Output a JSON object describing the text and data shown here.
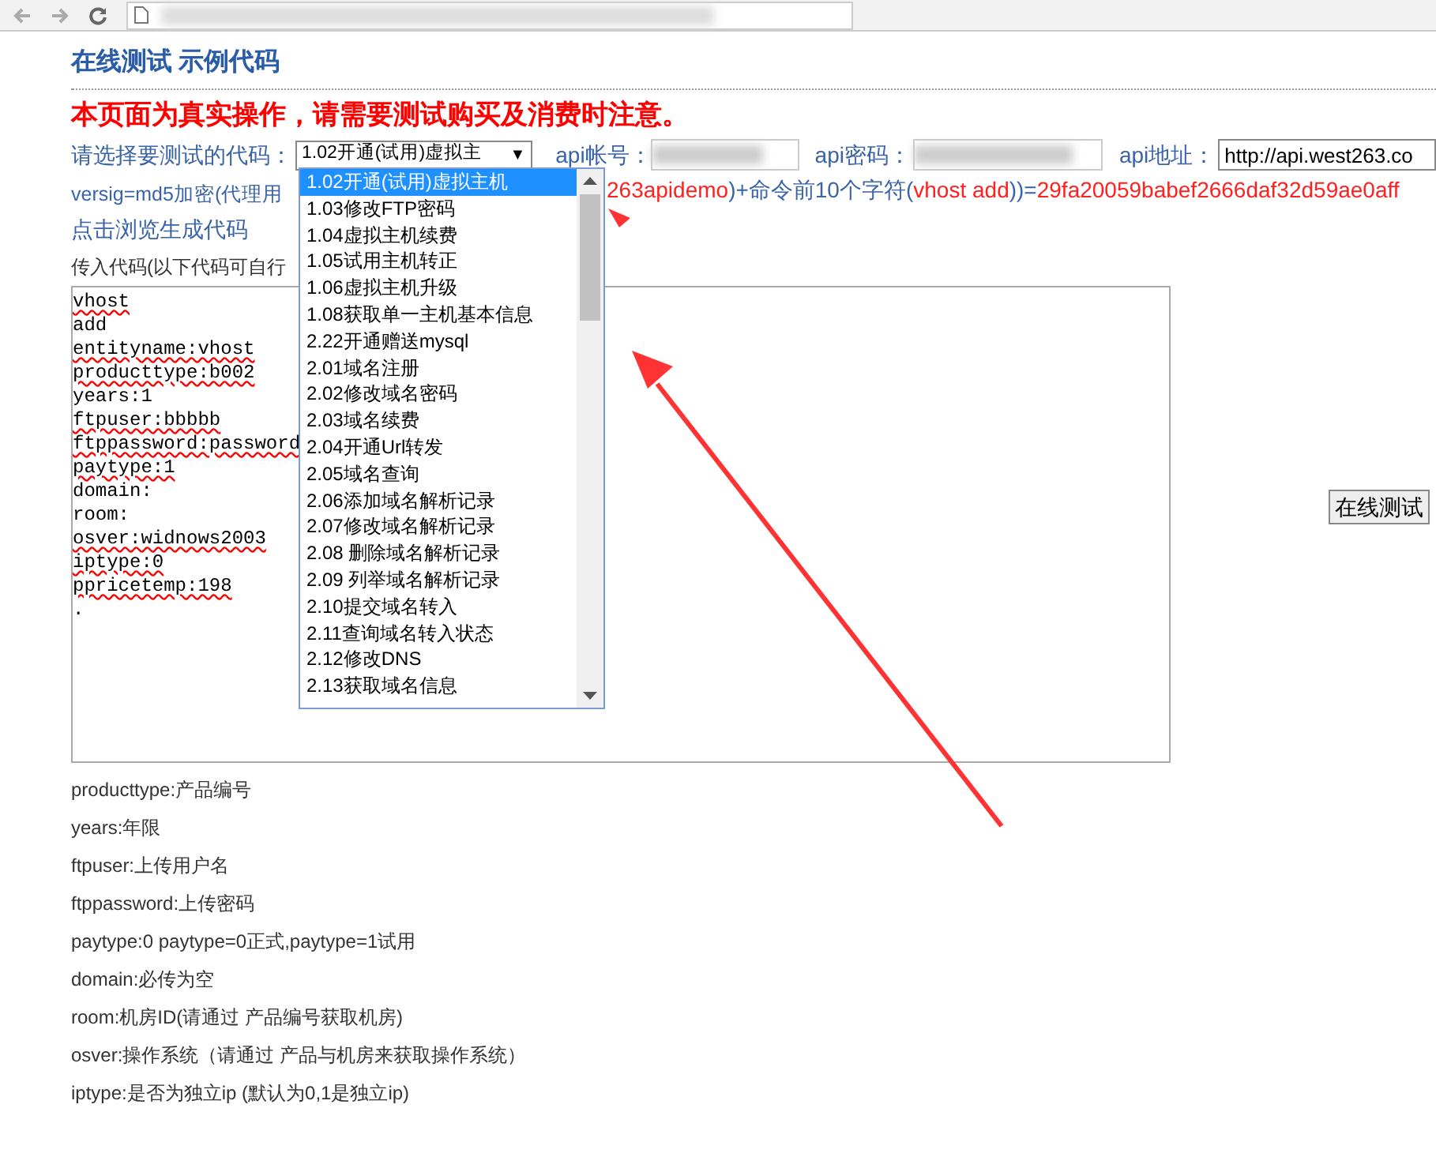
{
  "page_title": {
    "part_1": "在线测试",
    "part_2": "示例代码"
  },
  "warning": "本页面为真实操作，请需要测试购买及消费时注意。",
  "form": {
    "select_label": "请选择要测试的代码：",
    "select_value": "1.02开通(试用)虚拟主",
    "select_caret": "▼",
    "account_label": "api帐号：",
    "password_label": "api密码：",
    "address_label": "api地址：",
    "address_value": "http://api.west263.co"
  },
  "versig_left": "versig=md5加密(代理用",
  "versig_right": [
    {
      "text": "263apidemo",
      "highlight": true
    },
    {
      "text": ")+命令前10个字符(",
      "highlight": false
    },
    {
      "text": "vhost add",
      "highlight": true
    },
    {
      "text": "))=",
      "highlight": false
    },
    {
      "text": "29fa20059babef2666daf32d59ae0aff",
      "highlight": true
    }
  ],
  "generate_link": "点击浏览生成代码",
  "code_label": "传入代码(以下代码可自行",
  "code_lines": [
    {
      "text": "vhost",
      "flagged": true
    },
    {
      "text": "add",
      "flagged": false
    },
    {
      "text": "entityname:vhost",
      "flagged": true
    },
    {
      "text": "producttype:b002",
      "flagged": true
    },
    {
      "text": "years:1",
      "flagged": false
    },
    {
      "text": "ftpuser:bbbbb",
      "flagged": true
    },
    {
      "text": "ftppassword:password",
      "flagged": true
    },
    {
      "text": "paytype:1",
      "flagged": true
    },
    {
      "text": "domain:",
      "flagged": false
    },
    {
      "text": "room:",
      "flagged": false
    },
    {
      "text": "osver:widnows2003",
      "flagged": true
    },
    {
      "text": "iptype:0",
      "flagged": true
    },
    {
      "text": "ppricetemp:198",
      "flagged": true
    },
    {
      "text": ".",
      "flagged": false
    }
  ],
  "dropdown_options": [
    {
      "label": "1.02开通(试用)虚拟主机",
      "selected": true
    },
    {
      "label": "1.03修改FTP密码",
      "selected": false
    },
    {
      "label": "1.04虚拟主机续费",
      "selected": false
    },
    {
      "label": "1.05试用主机转正",
      "selected": false
    },
    {
      "label": "1.06虚拟主机升级",
      "selected": false
    },
    {
      "label": "1.08获取单一主机基本信息",
      "selected": false
    },
    {
      "label": "2.22开通赠送mysql",
      "selected": false
    },
    {
      "label": "2.01域名注册",
      "selected": false
    },
    {
      "label": "2.02修改域名密码",
      "selected": false
    },
    {
      "label": "2.03域名续费",
      "selected": false
    },
    {
      "label": "2.04开通Url转发",
      "selected": false
    },
    {
      "label": "2.05域名查询",
      "selected": false
    },
    {
      "label": "2.06添加域名解析记录",
      "selected": false
    },
    {
      "label": "2.07修改域名解析记录",
      "selected": false
    },
    {
      "label": "2.08 删除域名解析记录",
      "selected": false
    },
    {
      "label": "2.09 列举域名解析记录",
      "selected": false
    },
    {
      "label": "2.10提交域名转入",
      "selected": false
    },
    {
      "label": "2.11查询域名转入状态",
      "selected": false
    },
    {
      "label": "2.12修改DNS",
      "selected": false
    },
    {
      "label": "2.13获取域名信息",
      "selected": false
    }
  ],
  "test_button": "在线测试",
  "help_lines": [
    "producttype:产品编号",
    "years:年限",
    "ftpuser:上传用户名",
    "ftppassword:上传密码",
    "paytype:0 paytype=0正式,paytype=1试用",
    "domain:必传为空",
    "room:机房ID(请通过 产品编号获取机房)",
    "osver:操作系统（请通过 产品与机房来获取操作系统）",
    "iptype:是否为独立ip (默认为0,1是独立ip)"
  ]
}
